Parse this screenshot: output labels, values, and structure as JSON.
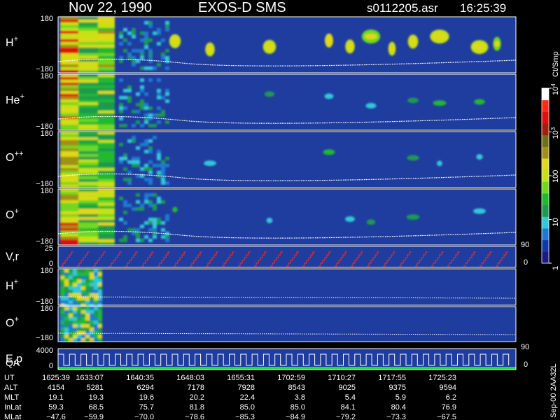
{
  "header": {
    "date": "Nov 22, 1990",
    "instrument": "EXOS-D SMS",
    "file": "s0112205.asr",
    "time": "16:25:39"
  },
  "colors": {
    "background": "#000000",
    "text": "#ffffff",
    "trace_red": "#ff2a1a",
    "trace_white": "#ffffff",
    "qa_green": "#22dd33",
    "panel_bg": "#1f3c9f"
  },
  "panels": [
    {
      "key": "h_plus",
      "label": "H",
      "sup": "+",
      "ymax": "180",
      "ymin": "−180",
      "intensity": 0.95
    },
    {
      "key": "he_plus",
      "label": "He",
      "sup": "+",
      "ymax": "180",
      "ymin": "−180",
      "intensity": 0.7
    },
    {
      "key": "o_pp",
      "label": "O",
      "sup": "++",
      "ymax": "180",
      "ymin": "−180",
      "intensity": 0.65
    },
    {
      "key": "o_plus",
      "label": "O",
      "sup": "+",
      "ymax": "180",
      "ymin": "−180",
      "intensity": 0.75
    },
    {
      "key": "vr",
      "label": "V,r",
      "sup": "",
      "ymax": "25",
      "ymin": "0"
    },
    {
      "key": "h_plus_2",
      "label": "H",
      "sup": "+",
      "ymax": "180",
      "ymin": "−180"
    },
    {
      "key": "o_plus_2",
      "label": "O",
      "sup": "+",
      "ymax": "180",
      "ymin": "−180"
    },
    {
      "key": "ep",
      "label": "E,p",
      "sup": "",
      "ymax": "4000",
      "ymin": "0"
    }
  ],
  "qa_label": "QA",
  "right_axis": {
    "vr": {
      "top": "90",
      "bottom": "0"
    },
    "ep": {
      "top": "90",
      "bottom": "0"
    }
  },
  "colorbar": {
    "unit": "Ct/Smp",
    "ticks": [
      {
        "label": "10",
        "sup": "4",
        "frac": 1.0
      },
      {
        "label": "10",
        "sup": "3",
        "frac": 0.75
      },
      {
        "label": "100",
        "sup": "",
        "frac": 0.5
      },
      {
        "label": "10",
        "sup": "",
        "frac": 0.25
      },
      {
        "label": "1",
        "sup": "",
        "frac": 0.0
      }
    ],
    "colors": [
      "#1a1a80",
      "#0d3aa8",
      "#1e7ad0",
      "#30c8d8",
      "#1e9a50",
      "#20b830",
      "#70d820",
      "#c8e018",
      "#e0d818",
      "#a09018",
      "#707018",
      "#a02010",
      "#e01010",
      "#ff2a1a",
      "#ffffff"
    ]
  },
  "annotation": {
    "vertical": "Sep-00  2AA32L"
  },
  "chart_data": {
    "type": "heatmap",
    "title": "Nov 22, 1990    EXOS-D SMS",
    "xlabel": "UT",
    "colorbar_label": "Ct/Smp",
    "colorbar_scale": "log",
    "colorbar_range": [
      1,
      10000
    ],
    "panel_yrange": [
      -180,
      180
    ],
    "time_ticks": [
      "1625:39",
      "1633:07",
      "1640:35",
      "1648:03",
      "1655:31",
      "1702:59",
      "1710:27",
      "1717:55",
      "1725:23"
    ],
    "ephemeris": [
      {
        "name": "UT",
        "values": [
          "1625:39",
          "1633:07",
          "1640:35",
          "1648:03",
          "1655:31",
          "1702:59",
          "1710:27",
          "1717:55",
          "1725:23"
        ]
      },
      {
        "name": "ALT",
        "values": [
          "4154",
          "5281",
          "6294",
          "7178",
          "7928",
          "8543",
          "9025",
          "9375",
          "9594"
        ]
      },
      {
        "name": "MLT",
        "values": [
          "19.1",
          "19.3",
          "19.6",
          "20.2",
          "22.4",
          "3.8",
          "5.4",
          "5.9",
          "6.2"
        ]
      },
      {
        "name": "InLat",
        "values": [
          "59.3",
          "68.5",
          "75.7",
          "81.8",
          "85.0",
          "85.0",
          "84.1",
          "80.4",
          "76.9"
        ]
      },
      {
        "name": "MLat",
        "values": [
          "−47.6",
          "−59.9",
          "−70.0",
          "−78.6",
          "−85.3",
          "−84.9",
          "−79.2",
          "−73.3",
          "−67.5"
        ]
      }
    ]
  }
}
